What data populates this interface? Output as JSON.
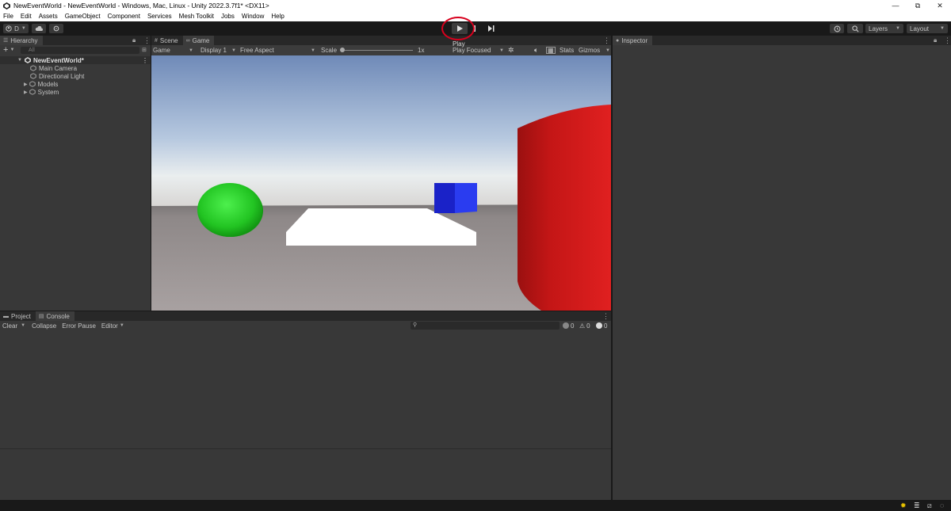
{
  "window": {
    "title": "NewEventWorld - NewEventWorld - Windows, Mac, Linux - Unity 2022.3.7f1* <DX11>",
    "minimize": "—",
    "maximize": "⧉",
    "close": "✕"
  },
  "menu": [
    "File",
    "Edit",
    "Assets",
    "GameObject",
    "Component",
    "Services",
    "Mesh Toolkit",
    "Jobs",
    "Window",
    "Help"
  ],
  "toolbar": {
    "account": "D",
    "layers": "Layers",
    "layout": "Layout",
    "play_tooltip": "Play"
  },
  "hierarchy": {
    "tab": "Hierarchy",
    "search_placeholder": "All",
    "scene": "NewEventWorld*",
    "items": [
      {
        "label": "Main Camera",
        "expandable": false
      },
      {
        "label": "Directional Light",
        "expandable": false
      },
      {
        "label": "Models",
        "expandable": true
      },
      {
        "label": "System",
        "expandable": true
      }
    ]
  },
  "game_view": {
    "tabs": [
      "Scene",
      "Game"
    ],
    "display_mode": "Game",
    "display": "Display 1",
    "aspect": "Free Aspect",
    "scale_label": "Scale",
    "scale_value": "1x",
    "play_focused": "Play Focused",
    "stats": "Stats",
    "gizmos": "Gizmos"
  },
  "inspector": {
    "tab": "Inspector"
  },
  "console": {
    "tabs": [
      "Project",
      "Console"
    ],
    "clear": "Clear",
    "collapse": "Collapse",
    "error_pause": "Error Pause",
    "editor": "Editor",
    "log_count": "0",
    "warning_count": "0",
    "error_count": "0"
  },
  "colors": {
    "sphere": "#22c422",
    "cube": "#1a2ae0",
    "cylinder": "#d81a1a",
    "accent_circle": "#d8001d"
  }
}
